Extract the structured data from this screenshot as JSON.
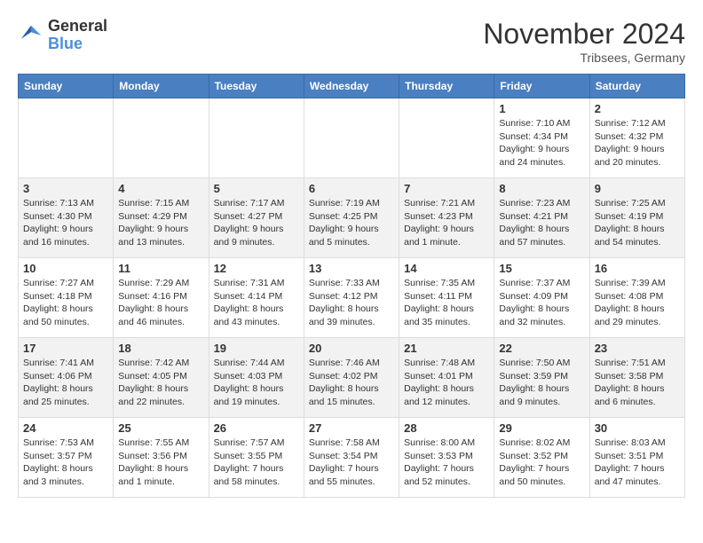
{
  "header": {
    "logo": {
      "general": "General",
      "blue": "Blue"
    },
    "title": "November 2024",
    "location": "Tribsees, Germany"
  },
  "calendar": {
    "days_of_week": [
      "Sunday",
      "Monday",
      "Tuesday",
      "Wednesday",
      "Thursday",
      "Friday",
      "Saturday"
    ],
    "weeks": [
      [
        {
          "day": "",
          "info": ""
        },
        {
          "day": "",
          "info": ""
        },
        {
          "day": "",
          "info": ""
        },
        {
          "day": "",
          "info": ""
        },
        {
          "day": "",
          "info": ""
        },
        {
          "day": "1",
          "info": "Sunrise: 7:10 AM\nSunset: 4:34 PM\nDaylight: 9 hours and 24 minutes."
        },
        {
          "day": "2",
          "info": "Sunrise: 7:12 AM\nSunset: 4:32 PM\nDaylight: 9 hours and 20 minutes."
        }
      ],
      [
        {
          "day": "3",
          "info": "Sunrise: 7:13 AM\nSunset: 4:30 PM\nDaylight: 9 hours and 16 minutes."
        },
        {
          "day": "4",
          "info": "Sunrise: 7:15 AM\nSunset: 4:29 PM\nDaylight: 9 hours and 13 minutes."
        },
        {
          "day": "5",
          "info": "Sunrise: 7:17 AM\nSunset: 4:27 PM\nDaylight: 9 hours and 9 minutes."
        },
        {
          "day": "6",
          "info": "Sunrise: 7:19 AM\nSunset: 4:25 PM\nDaylight: 9 hours and 5 minutes."
        },
        {
          "day": "7",
          "info": "Sunrise: 7:21 AM\nSunset: 4:23 PM\nDaylight: 9 hours and 1 minute."
        },
        {
          "day": "8",
          "info": "Sunrise: 7:23 AM\nSunset: 4:21 PM\nDaylight: 8 hours and 57 minutes."
        },
        {
          "day": "9",
          "info": "Sunrise: 7:25 AM\nSunset: 4:19 PM\nDaylight: 8 hours and 54 minutes."
        }
      ],
      [
        {
          "day": "10",
          "info": "Sunrise: 7:27 AM\nSunset: 4:18 PM\nDaylight: 8 hours and 50 minutes."
        },
        {
          "day": "11",
          "info": "Sunrise: 7:29 AM\nSunset: 4:16 PM\nDaylight: 8 hours and 46 minutes."
        },
        {
          "day": "12",
          "info": "Sunrise: 7:31 AM\nSunset: 4:14 PM\nDaylight: 8 hours and 43 minutes."
        },
        {
          "day": "13",
          "info": "Sunrise: 7:33 AM\nSunset: 4:12 PM\nDaylight: 8 hours and 39 minutes."
        },
        {
          "day": "14",
          "info": "Sunrise: 7:35 AM\nSunset: 4:11 PM\nDaylight: 8 hours and 35 minutes."
        },
        {
          "day": "15",
          "info": "Sunrise: 7:37 AM\nSunset: 4:09 PM\nDaylight: 8 hours and 32 minutes."
        },
        {
          "day": "16",
          "info": "Sunrise: 7:39 AM\nSunset: 4:08 PM\nDaylight: 8 hours and 29 minutes."
        }
      ],
      [
        {
          "day": "17",
          "info": "Sunrise: 7:41 AM\nSunset: 4:06 PM\nDaylight: 8 hours and 25 minutes."
        },
        {
          "day": "18",
          "info": "Sunrise: 7:42 AM\nSunset: 4:05 PM\nDaylight: 8 hours and 22 minutes."
        },
        {
          "day": "19",
          "info": "Sunrise: 7:44 AM\nSunset: 4:03 PM\nDaylight: 8 hours and 19 minutes."
        },
        {
          "day": "20",
          "info": "Sunrise: 7:46 AM\nSunset: 4:02 PM\nDaylight: 8 hours and 15 minutes."
        },
        {
          "day": "21",
          "info": "Sunrise: 7:48 AM\nSunset: 4:01 PM\nDaylight: 8 hours and 12 minutes."
        },
        {
          "day": "22",
          "info": "Sunrise: 7:50 AM\nSunset: 3:59 PM\nDaylight: 8 hours and 9 minutes."
        },
        {
          "day": "23",
          "info": "Sunrise: 7:51 AM\nSunset: 3:58 PM\nDaylight: 8 hours and 6 minutes."
        }
      ],
      [
        {
          "day": "24",
          "info": "Sunrise: 7:53 AM\nSunset: 3:57 PM\nDaylight: 8 hours and 3 minutes."
        },
        {
          "day": "25",
          "info": "Sunrise: 7:55 AM\nSunset: 3:56 PM\nDaylight: 8 hours and 1 minute."
        },
        {
          "day": "26",
          "info": "Sunrise: 7:57 AM\nSunset: 3:55 PM\nDaylight: 7 hours and 58 minutes."
        },
        {
          "day": "27",
          "info": "Sunrise: 7:58 AM\nSunset: 3:54 PM\nDaylight: 7 hours and 55 minutes."
        },
        {
          "day": "28",
          "info": "Sunrise: 8:00 AM\nSunset: 3:53 PM\nDaylight: 7 hours and 52 minutes."
        },
        {
          "day": "29",
          "info": "Sunrise: 8:02 AM\nSunset: 3:52 PM\nDaylight: 7 hours and 50 minutes."
        },
        {
          "day": "30",
          "info": "Sunrise: 8:03 AM\nSunset: 3:51 PM\nDaylight: 7 hours and 47 minutes."
        }
      ]
    ]
  }
}
